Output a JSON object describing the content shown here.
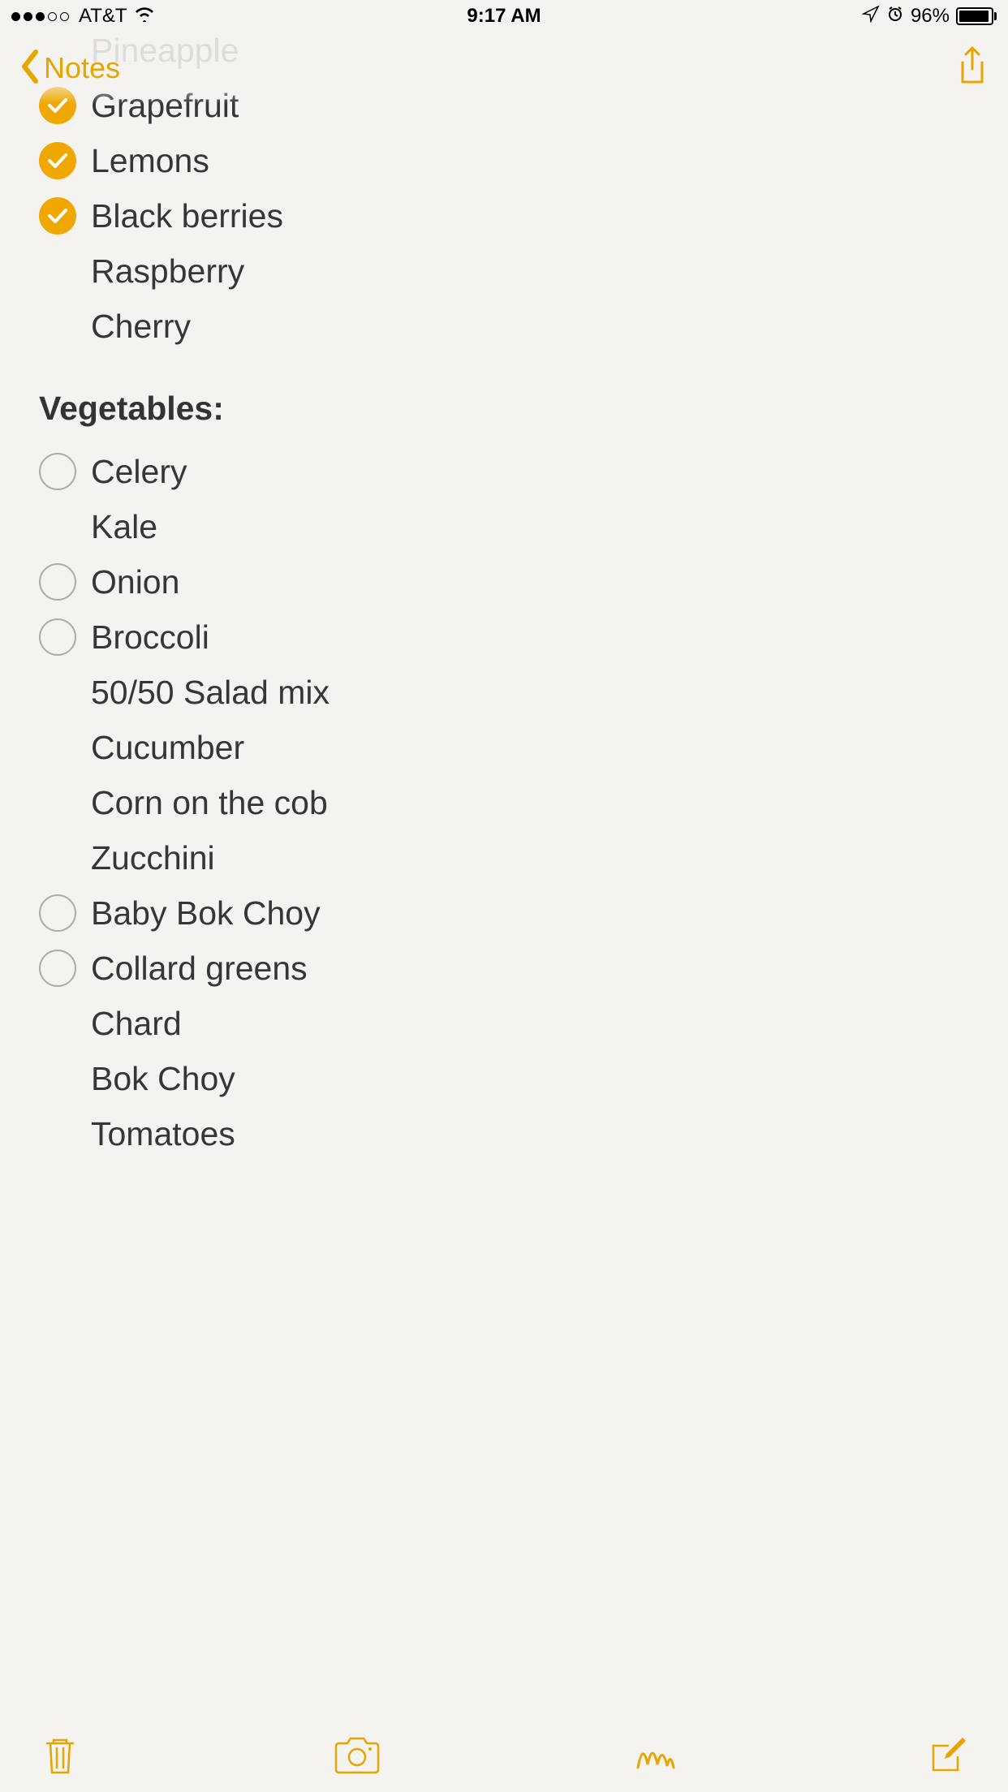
{
  "status_bar": {
    "carrier": "AT&T",
    "time": "9:17 AM",
    "battery_percent": "96%"
  },
  "nav": {
    "back_label": "Notes"
  },
  "colors": {
    "accent": "#e8a500",
    "checked": "#f0a800"
  },
  "note": {
    "fruits_partial": [
      {
        "label": "Pineapple",
        "checked": false,
        "has_checkbox": false
      },
      {
        "label": "Grapefruit",
        "checked": true,
        "has_checkbox": true
      },
      {
        "label": "Lemons",
        "checked": true,
        "has_checkbox": true
      },
      {
        "label": "Black berries",
        "checked": true,
        "has_checkbox": true
      },
      {
        "label": "Raspberry",
        "checked": false,
        "has_checkbox": false
      },
      {
        "label": "Cherry",
        "checked": false,
        "has_checkbox": false
      }
    ],
    "section_header": "Vegetables:",
    "vegetables": [
      {
        "label": "Celery",
        "checked": false,
        "has_checkbox": true
      },
      {
        "label": "Kale",
        "checked": false,
        "has_checkbox": false
      },
      {
        "label": "Onion",
        "checked": false,
        "has_checkbox": true
      },
      {
        "label": "Broccoli",
        "checked": false,
        "has_checkbox": true
      },
      {
        "label": "50/50 Salad mix",
        "checked": false,
        "has_checkbox": false
      },
      {
        "label": "Cucumber",
        "checked": false,
        "has_checkbox": false
      },
      {
        "label": "Corn on the cob",
        "checked": false,
        "has_checkbox": false
      },
      {
        "label": "Zucchini",
        "checked": false,
        "has_checkbox": false
      },
      {
        "label": "Baby Bok Choy",
        "checked": false,
        "has_checkbox": true
      },
      {
        "label": "Collard greens",
        "checked": false,
        "has_checkbox": true
      },
      {
        "label": "Chard",
        "checked": false,
        "has_checkbox": false
      },
      {
        "label": "Bok Choy",
        "checked": false,
        "has_checkbox": false
      },
      {
        "label": "Tomatoes",
        "checked": false,
        "has_checkbox": false
      }
    ]
  }
}
